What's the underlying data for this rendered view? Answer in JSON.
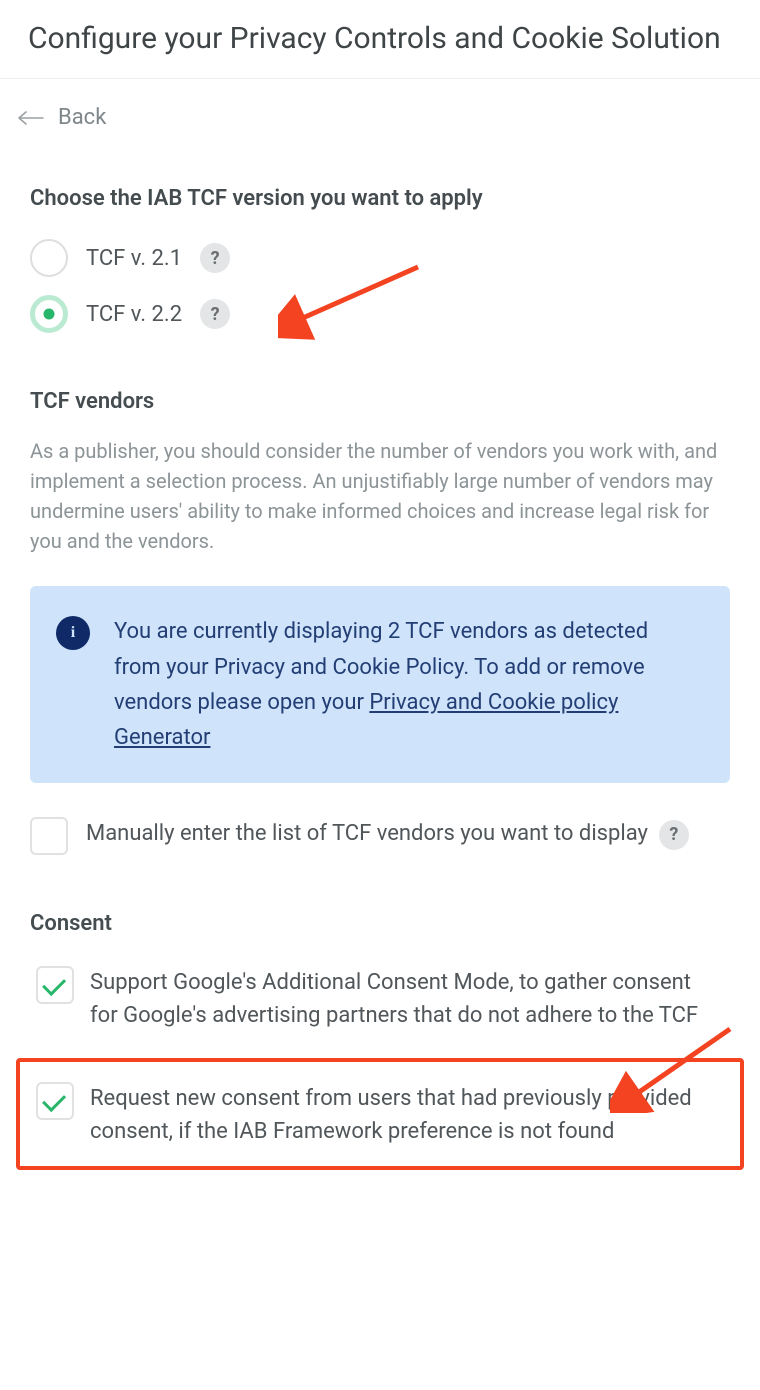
{
  "header": {
    "title": "Configure your Privacy Controls and Cookie Solution"
  },
  "back": {
    "label": "Back"
  },
  "tcf_version": {
    "heading": "Choose the IAB TCF version you want to apply",
    "options": [
      {
        "label": "TCF v. 2.1",
        "selected": false
      },
      {
        "label": "TCF v. 2.2",
        "selected": true
      }
    ],
    "help_glyph": "?"
  },
  "vendors": {
    "heading": "TCF vendors",
    "description": "As a publisher, you should consider the number of vendors you work with, and implement a selection process. An unjustifiably large number of vendors may undermine users' ability to make informed choices and increase legal risk for you and the vendors.",
    "info_prefix": "You are currently displaying 2 TCF vendors as detected from your Privacy and Cookie Policy. To add or remove vendors please open your ",
    "info_link": "Privacy and Cookie policy Generator",
    "manual_label": "Manually enter the list of TCF vendors you want to display",
    "manual_checked": false
  },
  "consent": {
    "heading": "Consent",
    "items": [
      {
        "label": "Support Google's Additional Consent Mode, to gather consent for Google's advertising partners that do not adhere to the TCF",
        "checked": true
      },
      {
        "label": "Request new consent from users that had previously provided consent, if the IAB Framework preference is not found",
        "checked": true
      }
    ]
  },
  "annotations": {
    "arrow_color": "#f44321"
  }
}
